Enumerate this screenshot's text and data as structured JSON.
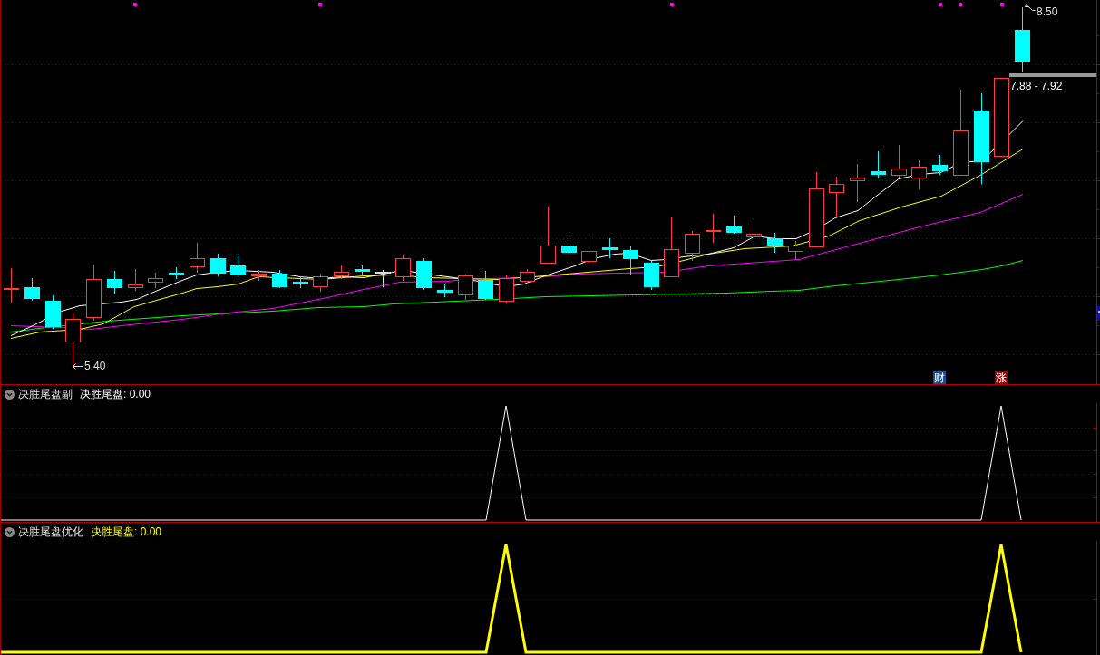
{
  "main_chart": {
    "high_label": "8.50",
    "low_label": "5.40",
    "price_range": "7.88 - 7.92",
    "event_tags": [
      {
        "text": "财",
        "color": "#1a4f8f"
      },
      {
        "text": "涨",
        "color": "#8c0a0a"
      }
    ]
  },
  "indicator_panels": [
    {
      "name": "决胜尾盘副",
      "series_label": "决胜尾盘: 0.00",
      "color": "#ffffff",
      "kind": "thin"
    },
    {
      "name": "决胜尾盘优化",
      "series_label": "决胜尾盘: 0.00",
      "color": "#ffff00",
      "kind": "thick"
    }
  ]
}
